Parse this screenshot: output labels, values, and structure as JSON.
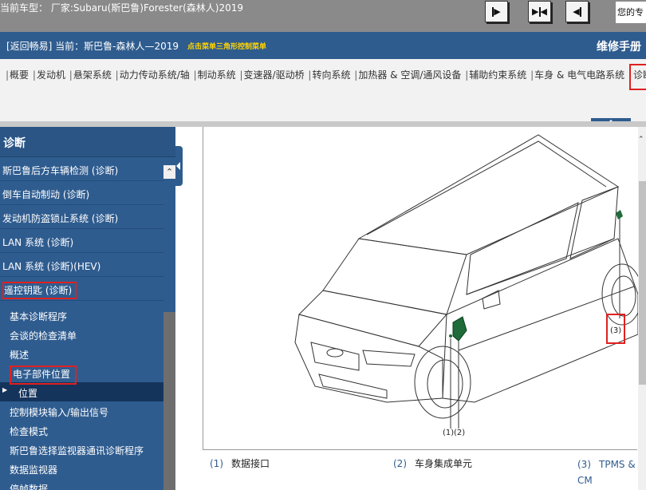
{
  "topbar": {
    "car_label": "当前车型： 厂家:Subaru(斯巴鲁)Forester(森林人)2019",
    "user_text": "您的专"
  },
  "header": {
    "back_text": "[返回畅易] 当前：斯巴鲁-森林人—2019",
    "hint_text": "点击菜单三角形控制菜单",
    "title": "维修手册"
  },
  "menu": {
    "items": [
      "概要",
      "发动机",
      "悬架系统",
      "动力传动系统/轴",
      "制动系统",
      "变速器/驱动桥",
      "转向系统",
      "加热器 & 空调/通风设备",
      "辅助约束系统",
      "车身 & 电气电路系统",
      "诊断"
    ]
  },
  "sidebar": {
    "title": "诊断",
    "sections": [
      "斯巴鲁后方车辆检测 (诊断)",
      "倒车自动制动 (诊断)",
      "发动机防盗锁止系统 (诊断)",
      "LAN 系统 (诊断)",
      "LAN 系统 (诊断)(HEV)",
      "遥控钥匙 (诊断)"
    ],
    "subitems": [
      "基本诊断程序",
      "会谈的检查清单",
      "概述",
      "电子部件位置",
      "位置",
      "控制模块输入/输出信号",
      "检查模式",
      "斯巴鲁选择监视器通讯诊断程序",
      "数据监视器",
      "停帧数据"
    ]
  },
  "figure": {
    "callouts": [
      "(1)",
      "(2)",
      "(3)"
    ]
  },
  "legend": [
    {
      "num": "(1)",
      "text": "数据接口"
    },
    {
      "num": "(2)",
      "text": "车身集成单元"
    },
    {
      "num": "(3)",
      "text": "TPMS & CM"
    }
  ],
  "colors": {
    "header_blue": "#2f5c8f",
    "highlight_red": "#e02020",
    "hint_yellow": "#ffd400",
    "component_green": "#1f6b3a"
  }
}
